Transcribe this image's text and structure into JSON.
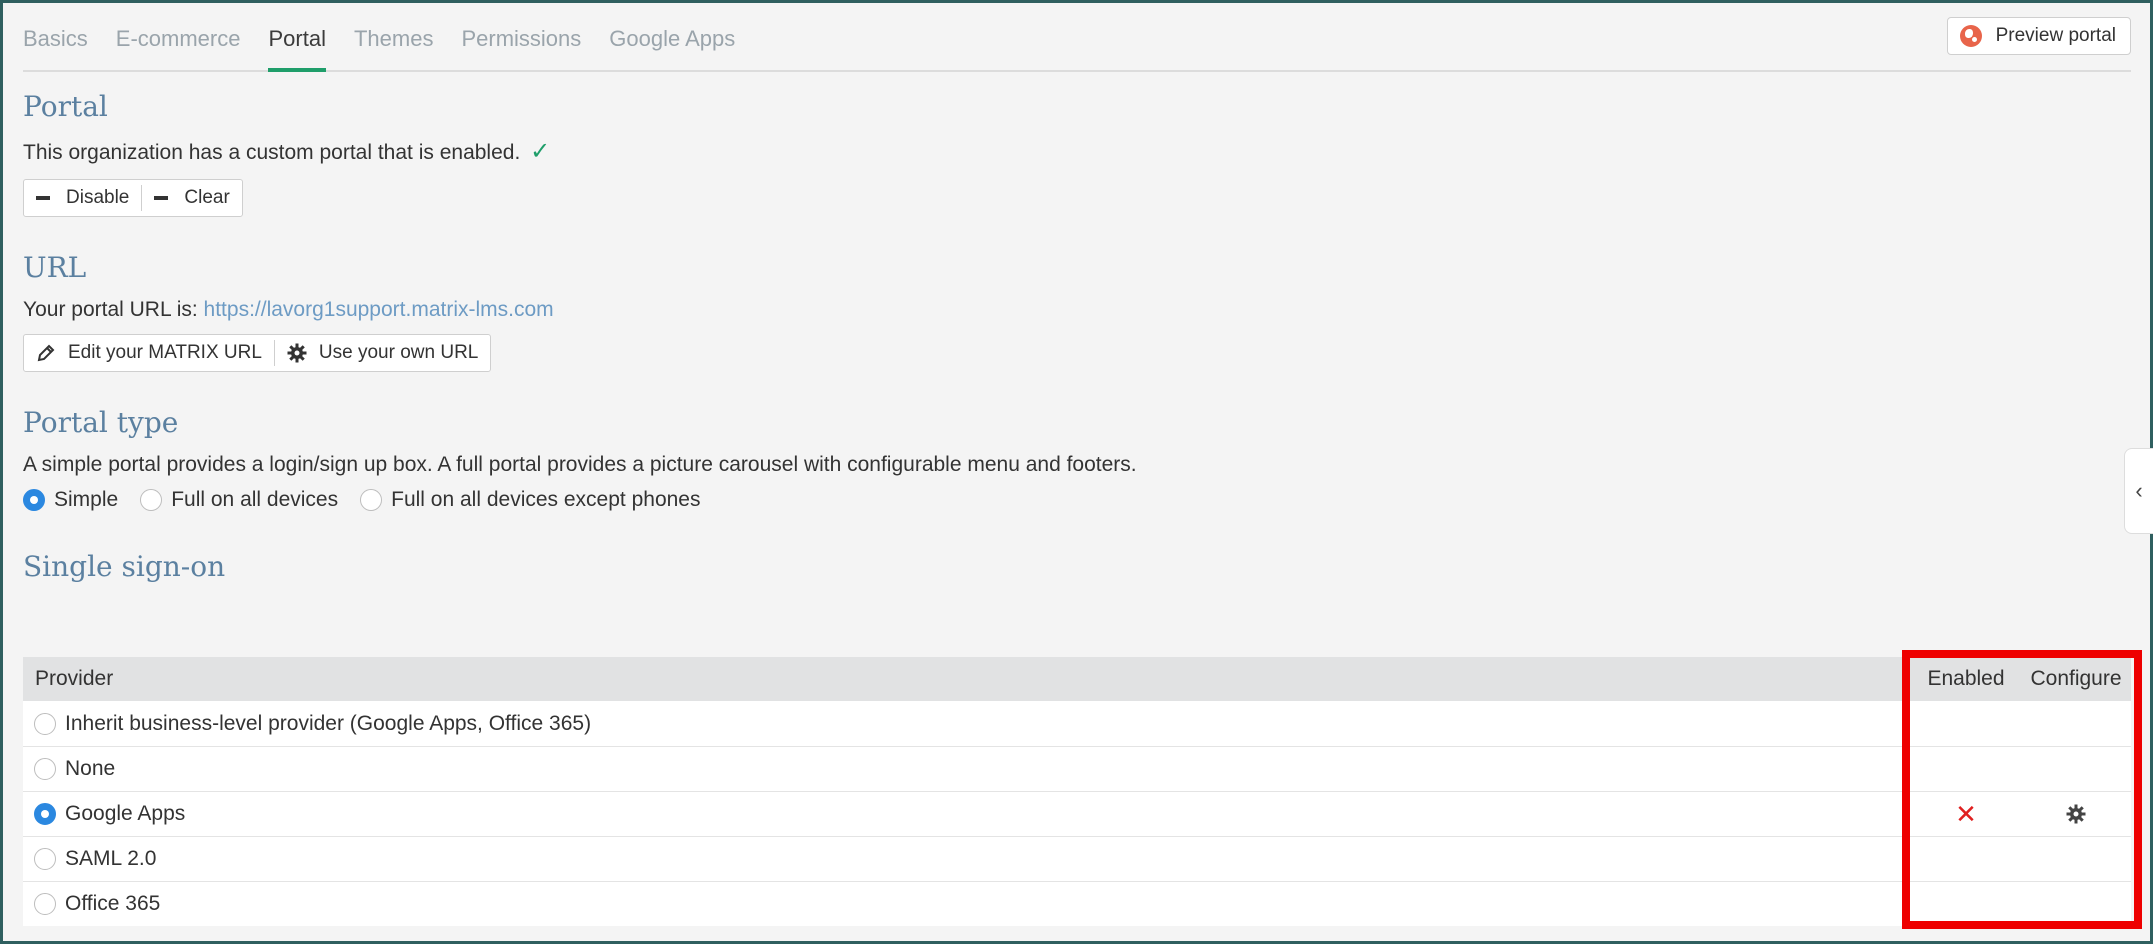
{
  "tabs": [
    {
      "label": "Basics",
      "active": false
    },
    {
      "label": "E-commerce",
      "active": false
    },
    {
      "label": "Portal",
      "active": true
    },
    {
      "label": "Themes",
      "active": false
    },
    {
      "label": "Permissions",
      "active": false
    },
    {
      "label": "Google Apps",
      "active": false
    }
  ],
  "preview_button": {
    "label": "Preview portal",
    "icon": "globe-icon"
  },
  "portal": {
    "heading": "Portal",
    "status_text": "This organization has a custom portal that is enabled.",
    "status_icon": "check-icon",
    "disable_label": "Disable",
    "clear_label": "Clear"
  },
  "url": {
    "heading": "URL",
    "prefix": "Your portal URL is:",
    "link": "https://lavorg1support.matrix-lms.com",
    "edit_label": "Edit your MATRIX URL",
    "own_label": "Use your own URL"
  },
  "portal_type": {
    "heading": "Portal type",
    "description": "A simple portal provides a login/sign up box. A full portal provides a picture carousel with configurable menu and footers.",
    "options": [
      {
        "label": "Simple",
        "selected": true
      },
      {
        "label": "Full on all devices",
        "selected": false
      },
      {
        "label": "Full on all devices except phones",
        "selected": false
      }
    ]
  },
  "sso": {
    "heading": "Single sign-on",
    "columns": {
      "provider": "Provider",
      "enabled": "Enabled",
      "configure": "Configure"
    },
    "rows": [
      {
        "provider": "Inherit business-level provider (Google Apps, Office 365)",
        "selected": false,
        "enabled_icon": "",
        "configure_icon": ""
      },
      {
        "provider": "None",
        "selected": false,
        "enabled_icon": "",
        "configure_icon": ""
      },
      {
        "provider": "Google Apps",
        "selected": true,
        "enabled_icon": "✕",
        "configure_icon": "gear-icon"
      },
      {
        "provider": "SAML 2.0",
        "selected": false,
        "enabled_icon": "",
        "configure_icon": ""
      },
      {
        "provider": "Office 365",
        "selected": false,
        "enabled_icon": "",
        "configure_icon": ""
      }
    ]
  },
  "colors": {
    "accent": "#1f9e6a",
    "heading": "#5b80a0",
    "link": "#6d9bc4",
    "radio_selected": "#2b88e0",
    "disabled_mark": "#e02020",
    "highlight_box": "#ee0000"
  }
}
